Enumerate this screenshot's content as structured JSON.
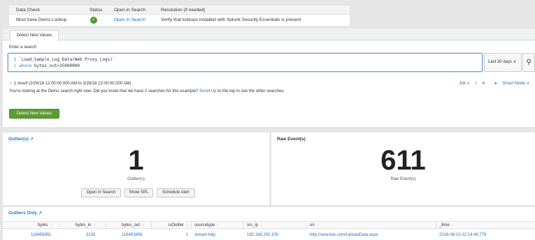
{
  "check_table": {
    "headers": [
      "Data Check",
      "Status",
      "Open in Search",
      "Resolution (if needed)"
    ],
    "row": {
      "check": "Must have Demo Lookup",
      "status_icon": "check-circle-icon",
      "open_link": "Open in Search",
      "resolution": "Verify that lookups installed with Splunk Security Essentials is present"
    }
  },
  "tab": {
    "label": "Detect New Values"
  },
  "search": {
    "label": "Enter a search",
    "line1": "| `Load_Sample_Log_Data(Web Proxy Logs)`",
    "line2_kw": "where",
    "line2_rest": " bytes_out>35000000",
    "time_range": "Last 30 days ∨",
    "search_icon": "magnifier-icon"
  },
  "result": {
    "check": "✓",
    "text": "1 result (2/26/18 12:00:00.000 AM to 3/28/18 12:00:00.000 AM)",
    "job": "Job ∨",
    "pause": "‖",
    "stop": "■",
    "smart_mode": "Smart Mode ∨"
  },
  "demo": {
    "text1": "You're looking at the ",
    "em": "Demo",
    "text2": " search right now. Did you know that we have 2 searches for this example? ",
    "link": "Scroll Up",
    "text3": " to the top to see the other searches."
  },
  "detect_button": "Detect New Values",
  "outlier_panel": {
    "title": "Outlier(s)",
    "value": "1",
    "sub": "Outlier(s)",
    "buttons": [
      "Open in Search",
      "Show SPL",
      "Schedule Alert"
    ]
  },
  "raw_panel": {
    "title": "Raw Event(s)",
    "value": "611",
    "sub": "Raw Event(s)"
  },
  "outliers_only": {
    "title": "Outliers Only",
    "columns": [
      "bytes",
      "bytes_in",
      "bytes_out",
      "isOutlier",
      "sourcetype",
      "src_ip",
      "uri",
      "_time"
    ],
    "sort_glyph": "↕",
    "row": [
      "116456991",
      "3135",
      "116453856",
      "1",
      "stream:http",
      "192.168.250.100",
      "http://sww.live.com/UploadData.aspx",
      "2016-08-10 22:14:49.779"
    ]
  },
  "colors": {
    "accent": "#1a73c8",
    "success": "#5a9e32"
  }
}
